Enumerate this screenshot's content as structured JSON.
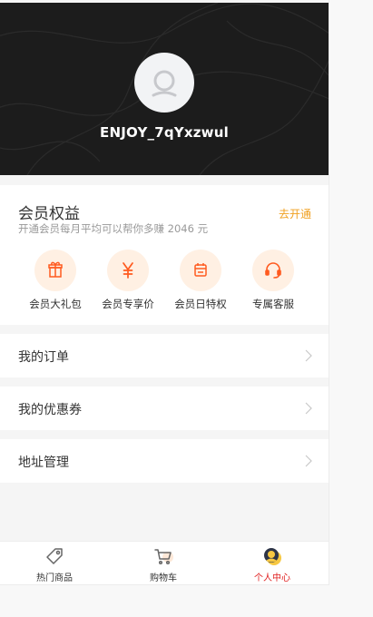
{
  "profile": {
    "username": "ENJOY_7qYxzwul"
  },
  "vip": {
    "title": "会员权益",
    "subtitle": "开通会员每月平均可以帮你多赚 2046 元",
    "open_label": "去开通",
    "accent_color": "#f0a020",
    "perks": [
      {
        "label": "会员大礼包",
        "icon": "gift-icon"
      },
      {
        "label": "会员专享价",
        "icon": "yen-icon"
      },
      {
        "label": "会员日特权",
        "icon": "calendar-icon"
      },
      {
        "label": "专属客服",
        "icon": "headset-icon"
      }
    ]
  },
  "menu": {
    "items": [
      {
        "label": "我的订单"
      },
      {
        "label": "我的优惠券"
      },
      {
        "label": "地址管理"
      }
    ]
  },
  "tabbar": {
    "items": [
      {
        "label": "热门商品",
        "icon": "tag-icon"
      },
      {
        "label": "购物车",
        "icon": "cart-icon"
      },
      {
        "label": "个人中心",
        "icon": "profile-icon"
      }
    ],
    "active": "个人中心",
    "active_color": "#e02020"
  }
}
